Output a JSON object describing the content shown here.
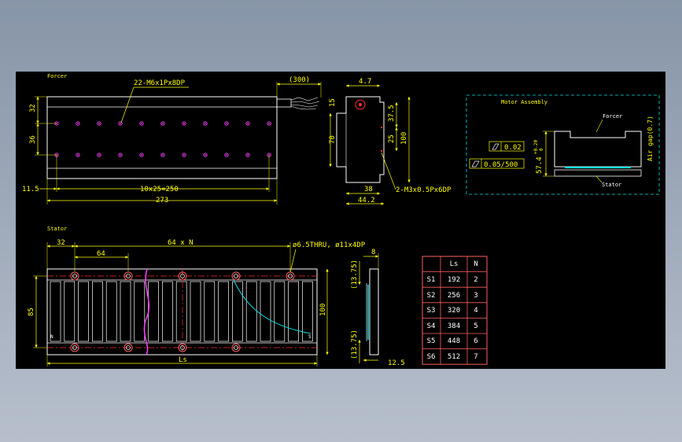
{
  "colors": {
    "background": "#000000",
    "outline": "#ffffff",
    "dimension": "#ffff00",
    "hidden_line": "#ff3030",
    "hole": "#ff40ff",
    "cyan": "#00e0e0",
    "table_border": "#ff6060",
    "label": "#ffff00"
  },
  "forcer": {
    "title": "Forcer",
    "hole_note": "22-M6x1Px8DP",
    "cable_note": "(300)",
    "dim_32": "32",
    "dim_36": "36",
    "dim_11_5": "11.5",
    "dim_pitch": "10x25=250",
    "dim_273": "273"
  },
  "side": {
    "dim_4_7": "4.7",
    "dim_15": "15",
    "dim_37_5": "37.5",
    "dim_70": "70",
    "dim_25": "25",
    "dim_100": "100",
    "dim_38": "38",
    "dim_44_2": "44.2",
    "note": "2-M3x0.5Px6DP"
  },
  "assembly": {
    "title": "Motor Assembly",
    "forcer_label": "Forcer",
    "stator_label": "Stator",
    "tol_parallel": "0.02",
    "tol_flat": "0.05/500",
    "height": "57.4",
    "height_tol_upper": "+0.20",
    "height_tol_lower": "0",
    "air_gap": "Air gap(0.7)"
  },
  "stator": {
    "title": "Stator",
    "dim_32": "32",
    "dim_64N": "64 x N",
    "dim_64": "64",
    "hole_note": "ø6.5THRU, ø11x4DP",
    "dim_85": "85",
    "dim_100": "100",
    "dim_ls": "Ls",
    "mark_n": "N",
    "mark_s": "S",
    "end_dim_8": "8",
    "end_dim_13_75_top": "(13.75)",
    "end_dim_13_75_bottom": "(13.75)",
    "end_dim_12_5": "12.5"
  },
  "table": {
    "headers": [
      "",
      "Ls",
      "N"
    ],
    "rows": [
      [
        "S1",
        "192",
        "2"
      ],
      [
        "S2",
        "256",
        "3"
      ],
      [
        "S3",
        "320",
        "4"
      ],
      [
        "S4",
        "384",
        "5"
      ],
      [
        "S5",
        "448",
        "6"
      ],
      [
        "S6",
        "512",
        "7"
      ]
    ]
  }
}
